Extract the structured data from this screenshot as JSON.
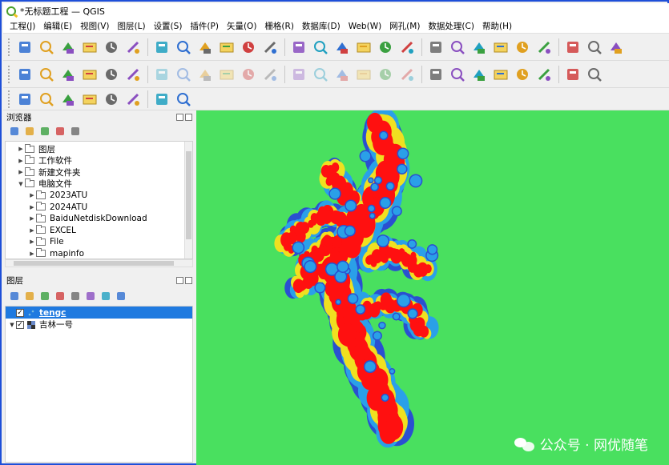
{
  "window": {
    "title": "*无标题工程 — QGIS"
  },
  "menubar": [
    "工程(J)",
    "编辑(E)",
    "视图(V)",
    "图层(L)",
    "设置(S)",
    "插件(P)",
    "矢量(O)",
    "栅格(R)",
    "数据库(D)",
    "Web(W)",
    "网孔(M)",
    "数据处理(C)",
    "帮助(H)"
  ],
  "toolbars": {
    "row1": [
      "new-project-icon",
      "open-project-icon",
      "save-project-icon",
      "save-as-icon",
      "print-layout-icon",
      "style-manager-icon",
      "pan-icon",
      "pan-to-selection-icon",
      "zoom-in-icon",
      "zoom-out-icon",
      "zoom-full-icon",
      "zoom-to-selection-icon",
      "zoom-to-layer-icon",
      "zoom-native-icon",
      "zoom-last-icon",
      "zoom-next-icon",
      "new-map-view-icon",
      "bookmark-icon",
      "show-bookmarks-icon",
      "temporal-controller-icon",
      "refresh-icon",
      "select-features-icon",
      "attribute-table-icon",
      "field-calculator-icon",
      "statistics-icon",
      "identify-icon",
      "measure-icon"
    ],
    "row2": [
      "add-vector-layer-icon",
      "add-raster-layer-icon",
      "add-delimited-text-icon",
      "digitize-icon",
      "add-wms-icon",
      "add-wfs-icon",
      "edit-pencil-icon",
      "toggle-editing-icon",
      "save-edits-icon",
      "add-feature-icon",
      "vertex-tool-icon",
      "node-tool-icon",
      "delete-icon",
      "cut-icon",
      "copy-icon",
      "paste-icon",
      "undo-icon",
      "redo-icon",
      "label-icon",
      "diagram-icon",
      "pin-label-icon",
      "show-label-icon",
      "move-label-icon",
      "rotate-label-icon",
      "change-label-icon",
      "label-tool-icon"
    ],
    "row3": [
      "annotation-icon",
      "measure-line-icon",
      "locate-icon",
      "zoom-pin-icon",
      "select-rect-icon",
      "globe-icon",
      "coordinate-icon",
      "tools-icon"
    ]
  },
  "browser_panel": {
    "title": "浏览器",
    "tools": [
      "add-selected-icon",
      "refresh-icon",
      "filter-icon",
      "collapse-icon",
      "properties-icon"
    ],
    "items": [
      {
        "label": "图层",
        "expanded": false,
        "level": 1
      },
      {
        "label": "工作软件",
        "expanded": false,
        "level": 1
      },
      {
        "label": "新建文件夹",
        "expanded": false,
        "level": 1
      },
      {
        "label": "电脑文件",
        "expanded": true,
        "level": 1
      },
      {
        "label": "2023ATU",
        "expanded": false,
        "level": 2
      },
      {
        "label": "2024ATU",
        "expanded": false,
        "level": 2
      },
      {
        "label": "BaiduNetdiskDownload",
        "expanded": false,
        "level": 2
      },
      {
        "label": "EXCEL",
        "expanded": false,
        "level": 2
      },
      {
        "label": "File",
        "expanded": false,
        "level": 2
      },
      {
        "label": "mapinfo",
        "expanded": false,
        "level": 2
      }
    ]
  },
  "layers_panel": {
    "title": "图层",
    "tools": [
      "style-icon",
      "add-group-icon",
      "visibility-icon",
      "filter-legend-icon",
      "filter-expression-icon",
      "expand-icon",
      "collapse-icon",
      "remove-icon"
    ],
    "layers": [
      {
        "name": "tengc",
        "checked": true,
        "selected": true,
        "type": "vector"
      },
      {
        "name": "吉林一号",
        "checked": true,
        "selected": false,
        "type": "raster"
      }
    ]
  },
  "map": {
    "background": "#49e05f",
    "watermark": "公众号 · 网优随笔"
  },
  "colors": {
    "accent": "#1f7ae0",
    "frame": "#1e4fd8",
    "heat_high": "#ff1010",
    "heat_mid": "#f0e020",
    "heat_low": "#2a50d0"
  }
}
